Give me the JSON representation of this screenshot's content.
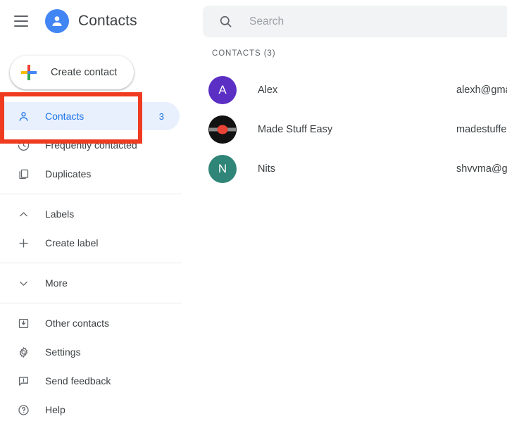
{
  "header": {
    "menu_icon": "hamburger-menu-icon",
    "logo_icon": "contacts-person-logo-icon",
    "title": "Contacts"
  },
  "create_button": {
    "label": "Create contact",
    "icon": "google-plus-icon",
    "highlight_color": "#ef3b20"
  },
  "sidebar": {
    "groups": [
      {
        "items": [
          {
            "label": "Contacts",
            "icon": "person-outline-icon",
            "count": "3",
            "active": true
          },
          {
            "label": "Frequently contacted",
            "icon": "history-clock-icon",
            "count": "",
            "active": false
          },
          {
            "label": "Duplicates",
            "icon": "copy-duplicate-icon",
            "count": "",
            "active": false
          }
        ]
      },
      {
        "items": [
          {
            "label": "Labels",
            "icon": "chevron-up-icon",
            "count": "",
            "active": false
          },
          {
            "label": "Create label",
            "icon": "plus-icon",
            "count": "",
            "active": false
          }
        ]
      },
      {
        "items": [
          {
            "label": "More",
            "icon": "chevron-down-icon",
            "count": "",
            "active": false
          }
        ]
      },
      {
        "items": [
          {
            "label": "Other contacts",
            "icon": "archive-box-icon",
            "count": "",
            "active": false
          },
          {
            "label": "Settings",
            "icon": "gear-icon",
            "count": "",
            "active": false
          },
          {
            "label": "Send feedback",
            "icon": "feedback-icon",
            "count": "",
            "active": false
          },
          {
            "label": "Help",
            "icon": "help-circle-icon",
            "count": "",
            "active": false
          }
        ]
      }
    ]
  },
  "search": {
    "placeholder": "Search",
    "value": "",
    "icon": "search-icon"
  },
  "contacts_list": {
    "section_label": "CONTACTS (3)",
    "rows": [
      {
        "name": "Alex",
        "email": "alexh@gma",
        "initial": "A",
        "avatar_color": "#5b2ec4",
        "avatar_type": "initial"
      },
      {
        "name": "Made Stuff Easy",
        "email": "madestuffe",
        "initial": "",
        "avatar_color": "#121212",
        "avatar_type": "image"
      },
      {
        "name": "Nits",
        "email": "shvvma@g",
        "initial": "N",
        "avatar_color": "#2f8577",
        "avatar_type": "initial"
      }
    ]
  }
}
